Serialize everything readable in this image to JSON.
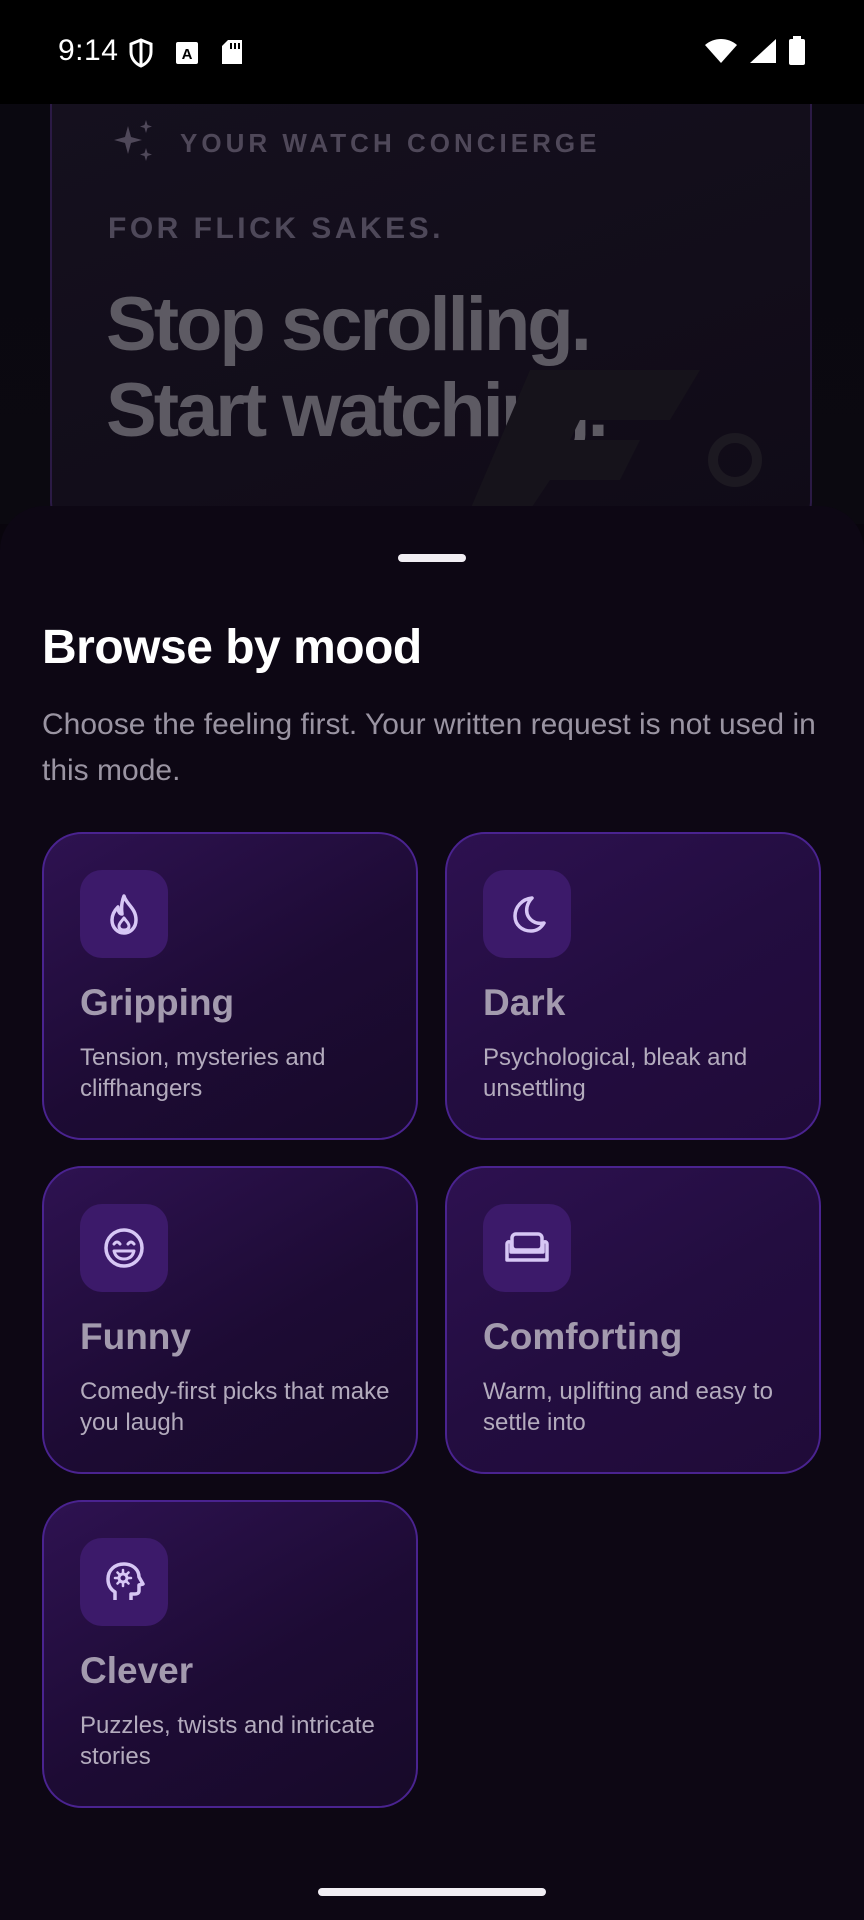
{
  "status_bar": {
    "time": "9:14"
  },
  "hero": {
    "tagline": "YOUR WATCH CONCIERGE",
    "kicker": "FOR FLICK SAKES.",
    "headline_line1": "Stop scrolling.",
    "headline_line2": "Start watching."
  },
  "sheet": {
    "title": "Browse by mood",
    "description": "Choose the feeling first. Your written request is not used in this mode.",
    "moods": [
      {
        "name": "Gripping",
        "description": "Tension, mysteries and cliffhangers",
        "icon": "flame-icon"
      },
      {
        "name": "Dark",
        "description": "Psychological, bleak and unsettling",
        "icon": "moon-icon"
      },
      {
        "name": "Funny",
        "description": "Comedy-first picks that make you laugh",
        "icon": "laughing-face-icon"
      },
      {
        "name": "Comforting",
        "description": "Warm, uplifting and easy to settle into",
        "icon": "sofa-icon"
      },
      {
        "name": "Clever",
        "description": "Puzzles, twists and intricate stories",
        "icon": "brain-head-icon"
      }
    ]
  },
  "colors": {
    "accent_border": "#4a2390",
    "icon_tint": "#d7c7f5",
    "card_bg": "#2e1251"
  }
}
